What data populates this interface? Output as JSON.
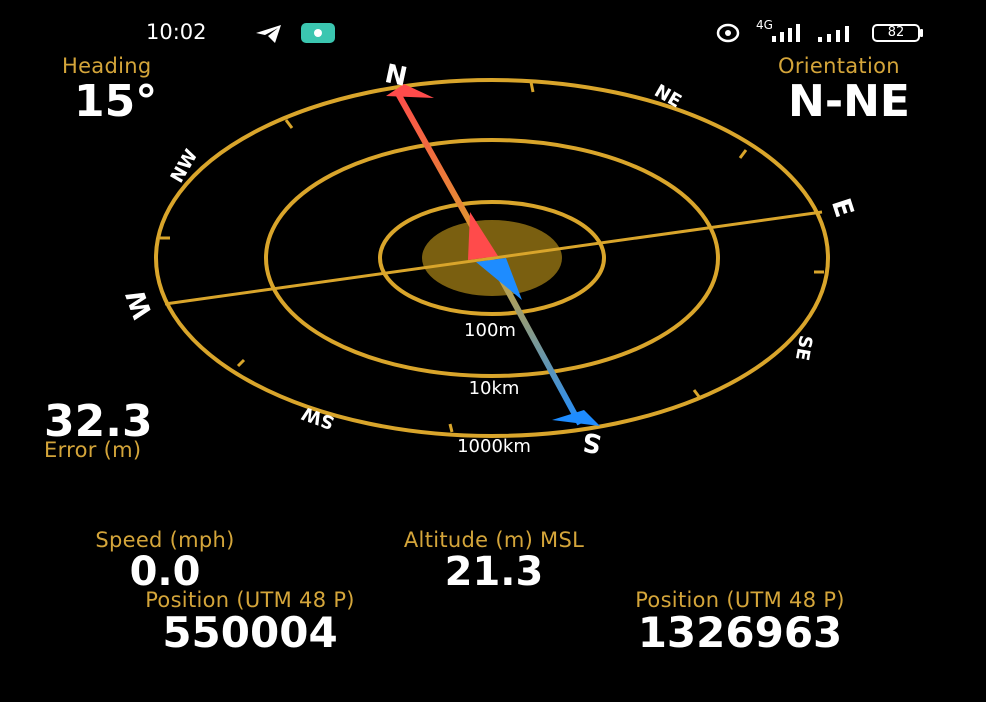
{
  "status_bar": {
    "time": "10:02",
    "network": "4G",
    "battery": "82",
    "icons": [
      "telegram-icon",
      "screen-record-icon",
      "location-icon",
      "wifi-signal-icon",
      "cellular-signal-icon",
      "battery-icon"
    ]
  },
  "heading": {
    "label": "Heading",
    "value": "15°",
    "degrees": 15
  },
  "orientation": {
    "label": "Orientation",
    "value": "N-NE"
  },
  "error": {
    "value": "32.3",
    "label": "Error (m)"
  },
  "compass": {
    "cardinals": {
      "n": "N",
      "ne": "NE",
      "e": "E",
      "se": "SE",
      "s": "S",
      "sw": "SW",
      "w": "W",
      "nw": "NW"
    },
    "rings": [
      "100m",
      "10km",
      "1000km"
    ],
    "colors": {
      "ring": "#d9a52b",
      "north_arrow": "#ff4b4b",
      "south_arrow": "#1e8cff",
      "center": "#7a5f10"
    }
  },
  "speed": {
    "label": "Speed (mph)",
    "value": "0.0"
  },
  "altitude": {
    "label": "Altitude (m) MSL",
    "value": "21.3"
  },
  "position_easting": {
    "label": "Position (UTM 48 P)",
    "value": "550004"
  },
  "position_northing": {
    "label": "Position (UTM 48 P)",
    "value": "1326963"
  }
}
